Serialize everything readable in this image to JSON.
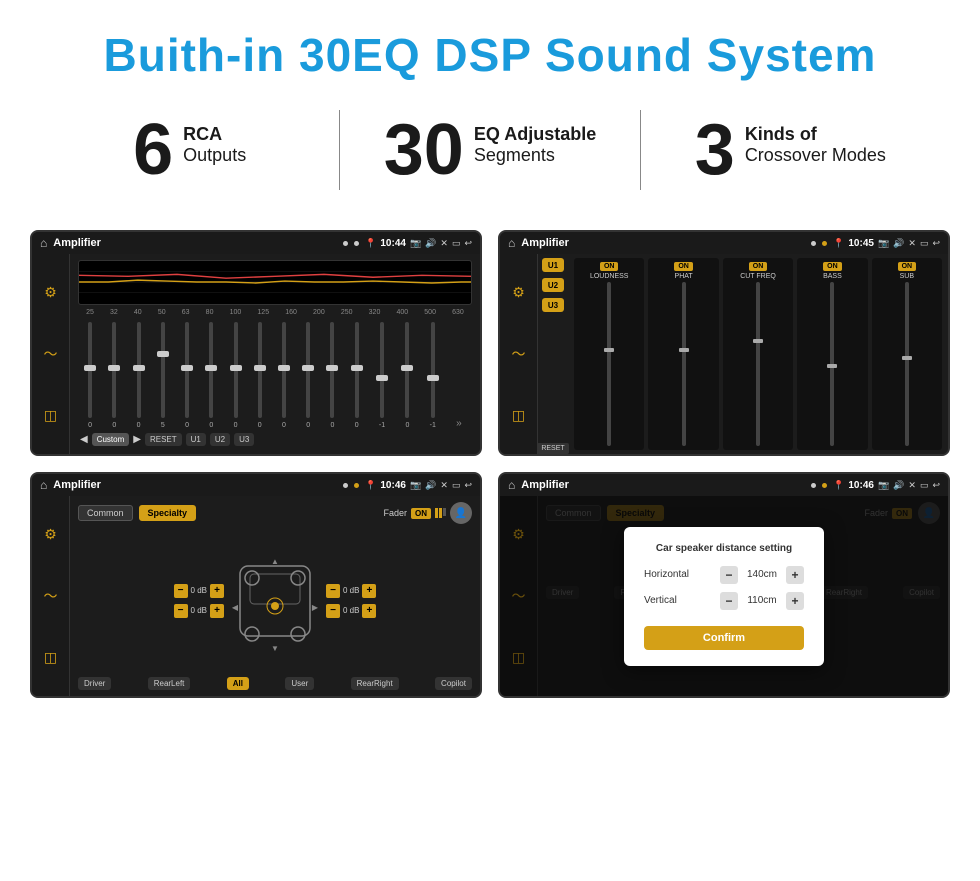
{
  "header": {
    "title": "Buith-in 30EQ DSP Sound System"
  },
  "stats": [
    {
      "number": "6",
      "line1": "RCA",
      "line2": "Outputs"
    },
    {
      "number": "30",
      "line1": "EQ Adjustable",
      "line2": "Segments"
    },
    {
      "number": "3",
      "line1": "Kinds of",
      "line2": "Crossover Modes"
    }
  ],
  "screens": {
    "screen1": {
      "title": "Amplifier",
      "time": "10:44",
      "eq_freqs": [
        "25",
        "32",
        "40",
        "50",
        "63",
        "80",
        "100",
        "125",
        "160",
        "200",
        "250",
        "320",
        "400",
        "500",
        "630"
      ],
      "eq_vals": [
        "0",
        "0",
        "0",
        "5",
        "0",
        "0",
        "0",
        "0",
        "0",
        "0",
        "0",
        "0",
        "-1",
        "0",
        "-1"
      ],
      "buttons": [
        "Custom",
        "RESET",
        "U1",
        "U2",
        "U3"
      ]
    },
    "screen2": {
      "title": "Amplifier",
      "time": "10:45",
      "presets": [
        "U1",
        "U2",
        "U3"
      ],
      "channels": [
        "LOUDNESS",
        "PHAT",
        "CUT FREQ",
        "BASS",
        "SUB"
      ],
      "reset_label": "RESET"
    },
    "screen3": {
      "title": "Amplifier",
      "time": "10:46",
      "tabs": [
        "Common",
        "Specialty"
      ],
      "fader_label": "Fader",
      "fader_state": "ON",
      "db_values": [
        "0 dB",
        "0 dB",
        "0 dB",
        "0 dB"
      ],
      "bottom_buttons": [
        "Driver",
        "RearLeft",
        "All",
        "User",
        "RearRight",
        "Copilot"
      ]
    },
    "screen4": {
      "title": "Amplifier",
      "time": "10:46",
      "dialog": {
        "title": "Car speaker distance setting",
        "horizontal_label": "Horizontal",
        "horizontal_value": "140cm",
        "vertical_label": "Vertical",
        "vertical_value": "110cm",
        "confirm_label": "Confirm"
      }
    }
  }
}
